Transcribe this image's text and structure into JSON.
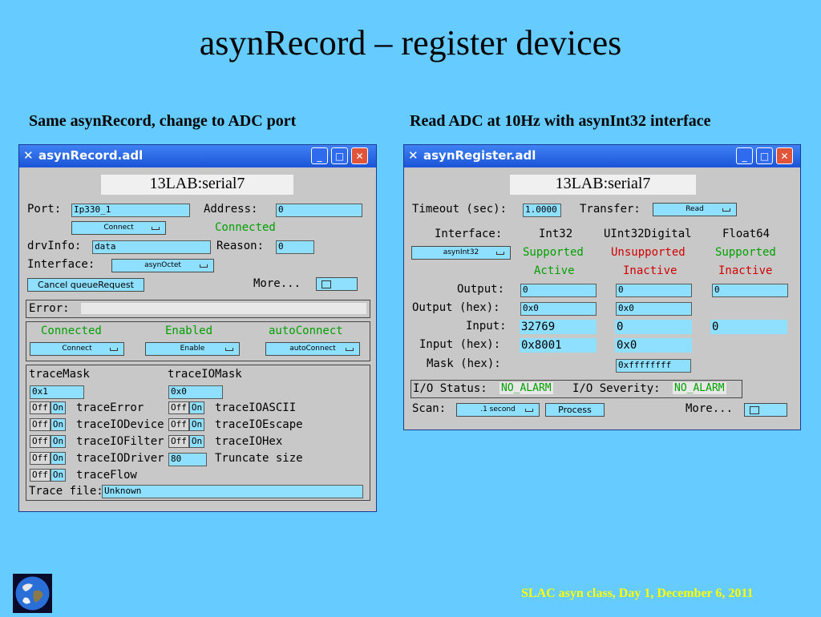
{
  "slide": {
    "title": "asynRecord – register devices",
    "caption_left": "Same asynRecord, change to ADC port",
    "caption_right": "Read ADC at 10Hz with asynInt32 interface",
    "footer": "SLAC asyn class, Day 1, December 6, 2011",
    "globe_icon": "earth-globe-icon"
  },
  "window_controls": {
    "minimize": "_",
    "maximize": "□",
    "close": "✕"
  },
  "asyn_record": {
    "title": "asynRecord.adl",
    "device": "13LAB:serial7",
    "port_label": "Port:",
    "port_value": "Ip330_1",
    "address_label": "Address:",
    "address_value": "0",
    "connect_menu": "Connect",
    "connected_status": "Connected",
    "drvinfo_label": "drvInfo:",
    "drvinfo_value": "data",
    "reason_label": "Reason:",
    "reason_value": "0",
    "interface_label": "Interface:",
    "interface_menu": "asynOctet",
    "cancel_button": "Cancel queueRequest",
    "more_label": "More...",
    "error_label": "Error:",
    "status": {
      "connected": "Connected",
      "enabled": "Enabled",
      "autoconnect": "autoConnect",
      "connect_menu": "Connect",
      "enable_menu": "Enable",
      "autoconnect_menu": "autoConnect"
    },
    "trace": {
      "mask_label": "traceMask",
      "mask_value": "0x1",
      "iomask_label": "traceIOMask",
      "iomask_value": "0x0",
      "off": "Off",
      "on": "On",
      "rows_left": [
        "traceError",
        "traceIODevice",
        "traceIOFilter",
        "traceIODriver",
        "traceFlow"
      ],
      "rows_right": [
        "traceIOASCII",
        "traceIOEscape",
        "traceIOHex"
      ],
      "truncate_value": "80",
      "truncate_label": "Truncate size",
      "file_label": "Trace file:",
      "file_value": "Unknown"
    }
  },
  "asyn_register": {
    "title": "asynRegister.adl",
    "device": "13LAB:serial7",
    "timeout_label": "Timeout (sec):",
    "timeout_value": "1.0000",
    "transfer_label": "Transfer:",
    "transfer_menu": "Read",
    "interface_label": "Interface:",
    "interface_menu": "asynInt32",
    "columns": [
      {
        "name": "Int32",
        "support": "Supported",
        "state": "Active"
      },
      {
        "name": "UInt32Digital",
        "support": "Unsupported",
        "state": "Inactive"
      },
      {
        "name": "Float64",
        "support": "Supported",
        "state": "Inactive"
      }
    ],
    "output_label": "Output:",
    "output_hex_label": "Output (hex):",
    "input_label": "Input:",
    "input_hex_label": "Input (hex):",
    "mask_hex_label": "Mask (hex):",
    "output_values": [
      "0",
      "0",
      "0"
    ],
    "output_hex_values": [
      "0x0",
      "0x0"
    ],
    "input_values": [
      "32769",
      "0",
      "0"
    ],
    "input_hex_values": [
      "0x8001",
      "0x0"
    ],
    "mask_value": "0xffffffff",
    "io_status_label": "I/O Status:",
    "io_status_value": "NO_ALARM",
    "io_severity_label": "I/O Severity:",
    "io_severity_value": "NO_ALARM",
    "scan_label": "Scan:",
    "scan_menu": ".1 second",
    "process_button": "Process",
    "more_label": "More..."
  }
}
